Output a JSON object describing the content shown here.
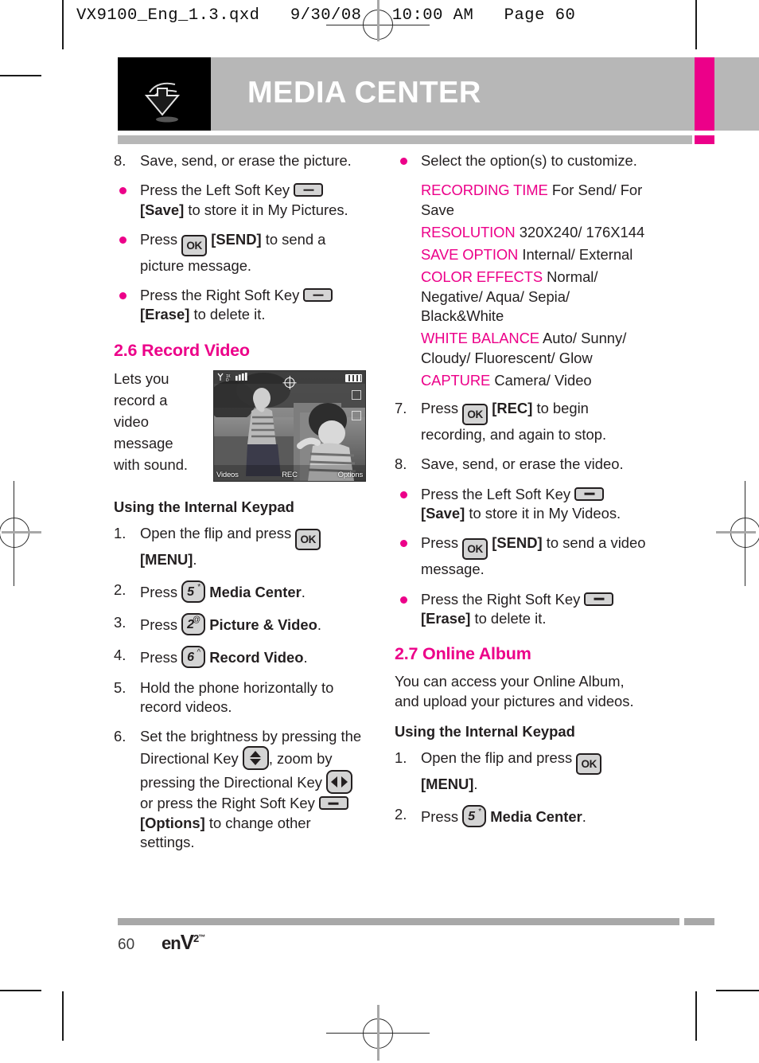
{
  "runhead": "VX9100_Eng_1.3.qxd   9/30/08   10:00 AM   Page 60",
  "header": {
    "title": "MEDIA CENTER",
    "icon": "download-arrow-icon",
    "bar_color": "#b7b7b7",
    "tab_color": "#ec0089"
  },
  "left_column": {
    "step8": {
      "marker": "8.",
      "text": "Save, send, or erase the picture."
    },
    "bullets": [
      {
        "pre": "Press the Left Soft Key",
        "key": "soft-key",
        "bold": "[Save]",
        "post": "to store it in My Pictures."
      },
      {
        "pre": "Press",
        "key": "ok-key",
        "bold": "[SEND]",
        "post": "to send a picture message."
      },
      {
        "pre": "Press the Right Soft Key",
        "key": "soft-key",
        "bold": "[Erase]",
        "post": "to delete it."
      }
    ],
    "section": {
      "heading": "2.6 Record Video",
      "lead": "Lets you record a video message with sound.",
      "figure": {
        "name": "record-video-screenshot",
        "status_left": "signal-bars",
        "softkey_left": "Videos",
        "softkey_center": "REC",
        "softkey_right": "Options"
      },
      "subhead": "Using the Internal Keypad",
      "steps": [
        {
          "marker": "1.",
          "pre": "Open the flip and press",
          "key": "ok-key",
          "bold": "[MENU]",
          "post": "."
        },
        {
          "marker": "2.",
          "pre": "Press",
          "key": "num-key",
          "digit": "5",
          "sup": "*",
          "bold": "Media Center",
          "post": "."
        },
        {
          "marker": "3.",
          "pre": "Press",
          "key": "num-key",
          "digit": "2",
          "sup": "@",
          "bold": "Picture & Video",
          "post": "."
        },
        {
          "marker": "4.",
          "pre": "Press",
          "key": "num-key",
          "digit": "6",
          "sup": "^",
          "bold": "Record Video",
          "post": "."
        },
        {
          "marker": "5.",
          "pre": "Hold the phone horizontally to record videos.",
          "key": "",
          "bold": "",
          "post": ""
        },
        {
          "marker": "6.",
          "pre": "Set the brightness by pressing the Directional Key",
          "key": "dir-key-vertical",
          "mid": ", zoom by pressing the Directional Key",
          "key2": "dir-key-horizontal",
          "mid2": "or press the Right Soft Key",
          "key3": "soft-key",
          "bold": "[Options]",
          "post": "to change other settings."
        }
      ]
    }
  },
  "right_column": {
    "customize_bullet": "Select the option(s) to customize.",
    "options": [
      {
        "key": "RECORDING TIME",
        "value": "For Send/ For Save"
      },
      {
        "key": "RESOLUTION",
        "value": "320X240/ 176X144"
      },
      {
        "key": "SAVE OPTION",
        "value": "Internal/ External"
      },
      {
        "key": "COLOR EFFECTS",
        "value": "Normal/ Negative/ Aqua/ Sepia/ Black&White"
      },
      {
        "key": "WHITE BALANCE",
        "value": "Auto/ Sunny/ Cloudy/ Fluorescent/ Glow"
      },
      {
        "key": "CAPTURE",
        "value": "Camera/ Video"
      }
    ],
    "step7": {
      "marker": "7.",
      "pre": "Press",
      "key": "ok-key",
      "bold": "[REC]",
      "post": "to begin recording, and again to stop."
    },
    "step8": {
      "marker": "8.",
      "text": "Save, send, or erase the video."
    },
    "bullets": [
      {
        "pre": "Press the Left Soft Key",
        "key": "soft-key",
        "bold": "[Save]",
        "post": "to store it in My Videos."
      },
      {
        "pre": "Press",
        "key": "ok-key",
        "bold": "[SEND]",
        "post": "to send a video message."
      },
      {
        "pre": "Press the Right Soft Key",
        "key": "soft-key",
        "bold": "[Erase]",
        "post": "to delete it."
      }
    ],
    "section": {
      "heading": "2.7 Online Album",
      "lead": "You can access your Online Album, and upload your pictures and videos.",
      "subhead": "Using the Internal Keypad",
      "steps": [
        {
          "marker": "1.",
          "pre": "Open the flip and press",
          "key": "ok-key",
          "bold": "[MENU]",
          "post": "."
        },
        {
          "marker": "2.",
          "pre": "Press",
          "key": "num-key",
          "digit": "5",
          "sup": "*",
          "bold": "Media Center",
          "post": "."
        }
      ]
    }
  },
  "footer": {
    "page_number": "60",
    "logo_en": "en",
    "logo_v": "V",
    "logo_sup": "2",
    "logo_tm": "™"
  },
  "keys": {
    "ok_label": "OK"
  }
}
